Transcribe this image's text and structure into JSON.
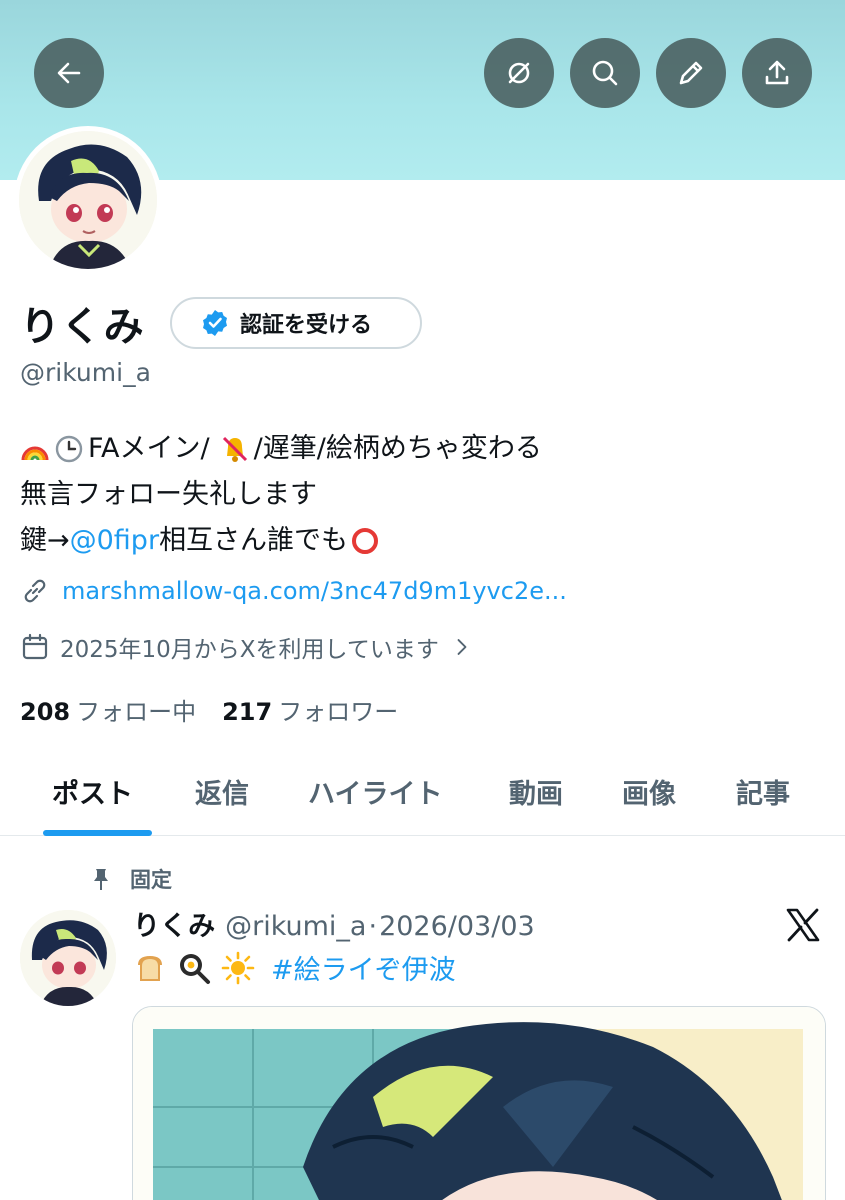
{
  "profile": {
    "name": "りくみ",
    "verify_label": "認証を受ける",
    "handle": "@rikumi_a",
    "bio": {
      "line1_a": "FAメイン/",
      "line1_b": "/遅筆/絵柄めちゃ変わる",
      "line2": "無言フォロー失礼します",
      "line3_a": "鍵→",
      "line3_link": "@0fipr",
      "line3_b": " 相互さん誰でも"
    },
    "website": "marshmallow-qa.com/3nc47d9m1yvc2e...",
    "joined": "2025年10月からXを利用しています",
    "following_count": "208",
    "following_label": "フォロー中",
    "followers_count": "217",
    "followers_label": "フォロワー"
  },
  "header": {
    "icons": [
      "back-arrow-icon",
      "grok-icon",
      "search-icon",
      "pencil-icon",
      "share-icon"
    ]
  },
  "tabs": [
    {
      "label": "ポスト",
      "active": true
    },
    {
      "label": "返信"
    },
    {
      "label": "ハイライト"
    },
    {
      "label": "動画"
    },
    {
      "label": "画像"
    },
    {
      "label": "記事"
    }
  ],
  "pinned_post": {
    "pinned_label": "固定",
    "author_name": "りくみ",
    "author_handle": "@rikumi_a",
    "separator": "·",
    "date": "2026/03/03",
    "hashtag": "#絵ライぞ伊波"
  },
  "colors": {
    "accent": "#1d9bf0",
    "banner": "#a9e6ea",
    "secondary_text": "#536471"
  }
}
